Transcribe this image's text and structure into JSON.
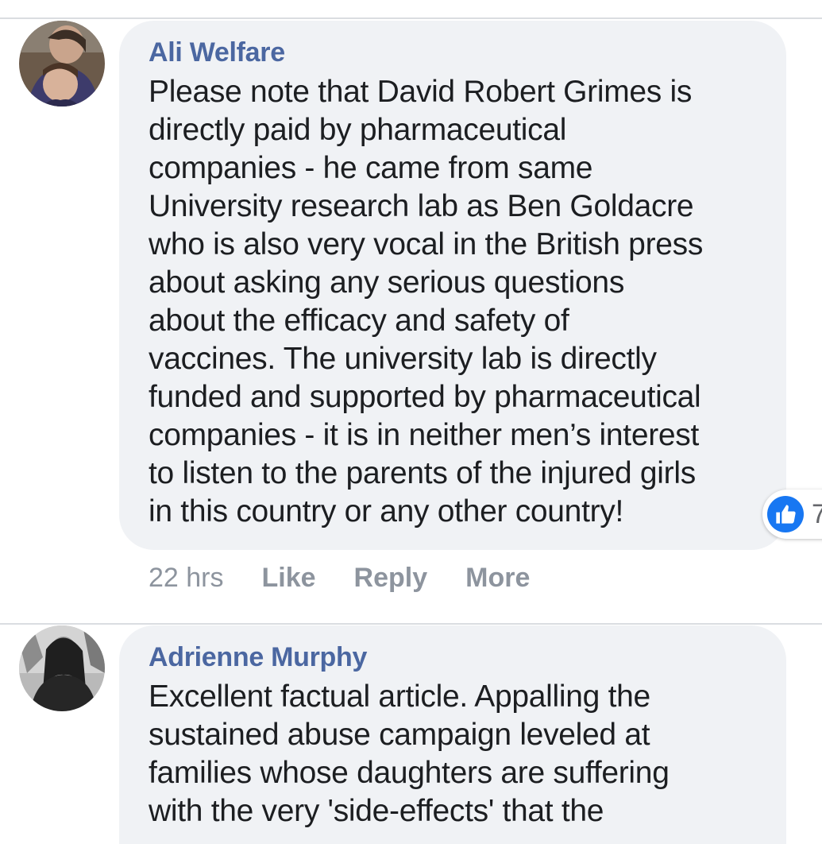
{
  "colors": {
    "author": "#4b67a1",
    "text": "#1c1e21",
    "meta": "#8d949e",
    "bubble": "#f0f2f5",
    "like_blue": "#1877f2"
  },
  "comments": [
    {
      "author": "Ali Welfare",
      "avatar_icon": "avatar-photo-icon",
      "text": "Please note that David Robert Grimes is\ndirectly paid by pharmaceutical\ncompanies - he came from same\nUniversity research lab as Ben Goldacre\nwho is also very vocal in the British press\nabout asking any serious questions\nabout the efficacy and safety of\nvaccines. The university lab is directly\nfunded and supported by pharmaceutical\ncompanies - it is in neither men’s interest\nto listen to the parents of the injured girls\nin this country or any other country!",
      "time": "22 hrs",
      "like_label": "Like",
      "reply_label": "Reply",
      "more_label": "More",
      "reaction_icon": "thumbs-up-icon",
      "reaction_count": "7"
    },
    {
      "author": "Adrienne Murphy",
      "avatar_icon": "avatar-photo-icon",
      "text": "Excellent factual article. Appalling the\nsustained abuse campaign leveled at\nfamilies whose daughters are suffering\nwith the very 'side-effects' that the"
    }
  ]
}
